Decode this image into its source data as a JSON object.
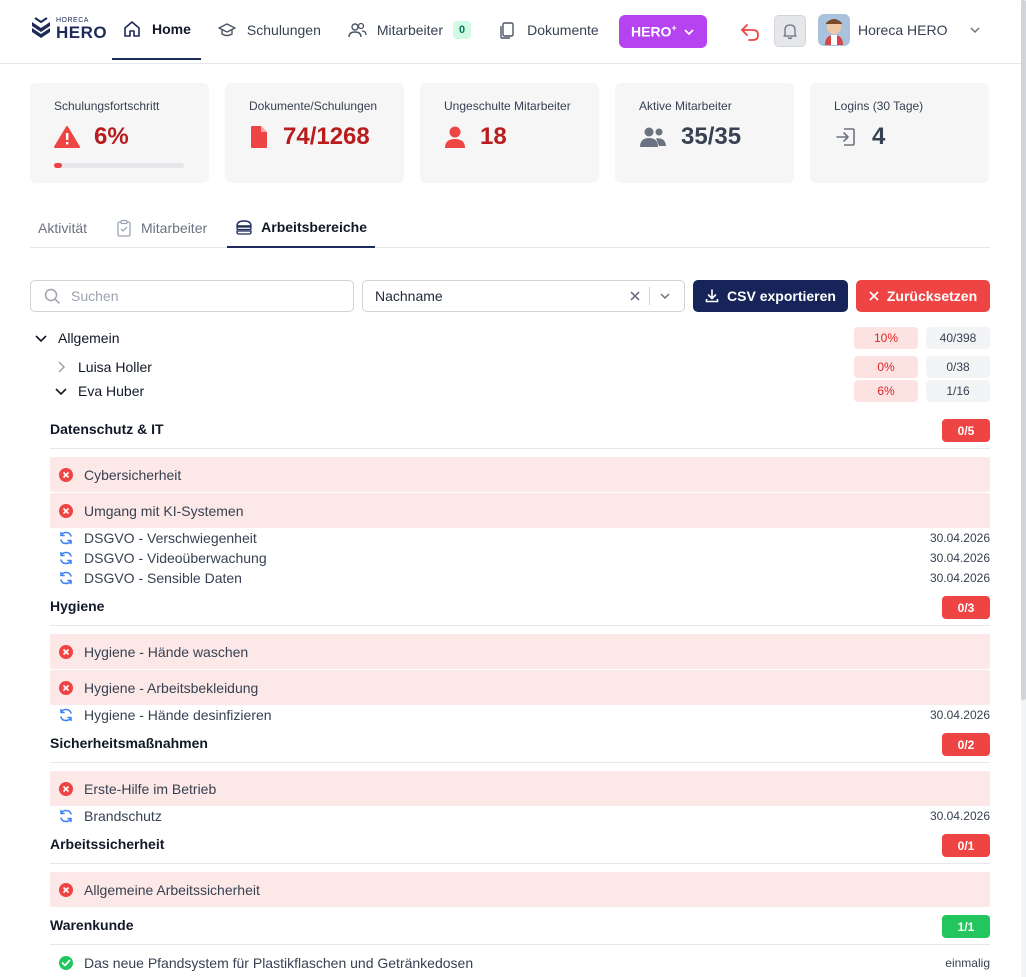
{
  "header": {
    "logo_small": "HORECA",
    "logo_big": "HERO",
    "nav": {
      "home": "Home",
      "schulungen": "Schulungen",
      "mitarbeiter": "Mitarbeiter",
      "mitarbeiter_badge": "0",
      "dokumente": "Dokumente"
    },
    "hero_button": "HERO",
    "hero_sup": "+",
    "user_name": "Horeca HERO"
  },
  "cards": [
    {
      "title": "Schulungsfortschritt",
      "value": "6%",
      "progress": 0.06,
      "icon": "warning-triangle-icon"
    },
    {
      "title": "Dokumente/Schulungen",
      "value": "74/1268",
      "icon": "file-icon"
    },
    {
      "title": "Ungeschulte Mitarbeiter",
      "value": "18",
      "icon": "user-icon"
    },
    {
      "title": "Aktive Mitarbeiter",
      "value": "35/35",
      "icon": "users-icon"
    },
    {
      "title": "Logins (30 Tage)",
      "value": "4",
      "icon": "login-icon"
    }
  ],
  "tabs": [
    "Aktivität",
    "Mitarbeiter",
    "Arbeitsbereiche"
  ],
  "toolbar": {
    "search_placeholder": "Suchen",
    "sort_value": "Nachname",
    "csv_label": "CSV exportieren",
    "reset_label": "Zurücksetzen"
  },
  "tree": {
    "group": {
      "label": "Allgemein",
      "pct": "10%",
      "count": "40/398"
    },
    "employees": [
      {
        "name": "Luisa Holler",
        "pct": "0%",
        "count": "0/38",
        "expanded": false
      },
      {
        "name": "Eva Huber",
        "pct": "6%",
        "count": "1/16",
        "expanded": true
      }
    ]
  },
  "sections": [
    {
      "title": "Datenschutz & IT",
      "score": "0/5",
      "status": "red",
      "items": [
        {
          "label": "Cybersicherheit",
          "state": "failed"
        },
        {
          "label": "Umgang mit KI-Systemen",
          "state": "failed"
        },
        {
          "label": "DSGVO - Verschwiegenheit",
          "state": "pending",
          "date": "30.04.2026"
        },
        {
          "label": "DSGVO - Videoüberwachung",
          "state": "pending",
          "date": "30.04.2026"
        },
        {
          "label": "DSGVO - Sensible Daten",
          "state": "pending",
          "date": "30.04.2026"
        }
      ]
    },
    {
      "title": "Hygiene",
      "score": "0/3",
      "status": "red",
      "items": [
        {
          "label": "Hygiene - Hände waschen",
          "state": "failed"
        },
        {
          "label": "Hygiene - Arbeitsbekleidung",
          "state": "failed"
        },
        {
          "label": "Hygiene - Hände desinfizieren",
          "state": "pending",
          "date": "30.04.2026"
        }
      ]
    },
    {
      "title": "Sicherheitsmaßnahmen",
      "score": "0/2",
      "status": "red",
      "items": [
        {
          "label": "Erste-Hilfe im Betrieb",
          "state": "failed"
        },
        {
          "label": "Brandschutz",
          "state": "pending",
          "date": "30.04.2026"
        }
      ]
    },
    {
      "title": "Arbeitssicherheit",
      "score": "0/1",
      "status": "red",
      "items": [
        {
          "label": "Allgemeine Arbeitssicherheit",
          "state": "failed"
        }
      ]
    },
    {
      "title": "Warenkunde",
      "score": "1/1",
      "status": "green",
      "items": [
        {
          "label": "Das neue Pfandsystem für Plastikflaschen und Getränkedosen",
          "state": "done",
          "date": "einmalig"
        }
      ]
    }
  ]
}
